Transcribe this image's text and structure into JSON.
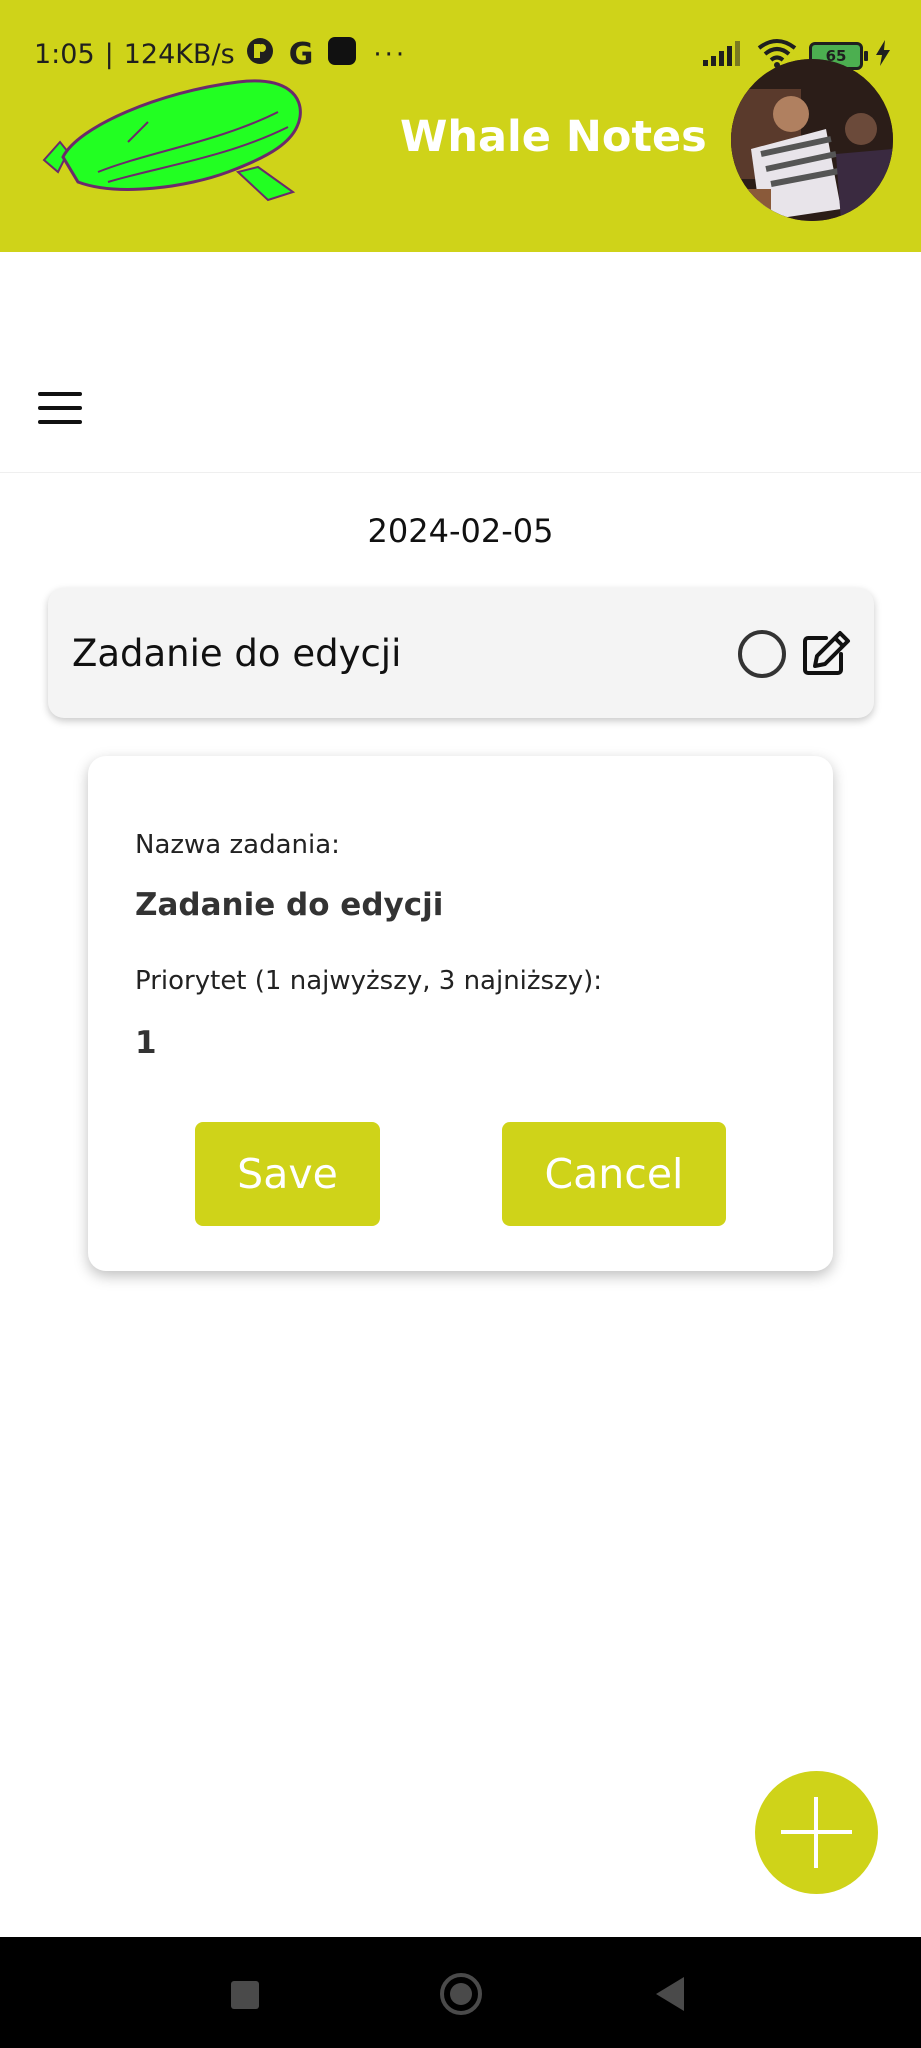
{
  "status_bar": {
    "time": "1:05",
    "separator": "|",
    "network_speed": "124KB/s",
    "icons": [
      "vpn-icon",
      "google-icon",
      "app-icon",
      "more-dots-icon",
      "signal-icon",
      "wifi-icon",
      "battery-icon",
      "charging-icon"
    ],
    "more": "···",
    "battery_level": "65"
  },
  "header": {
    "app_title": "Whale Notes",
    "background_color": "#cfd319",
    "logo": "whale-logo-icon",
    "avatar": "user-avatar"
  },
  "toolbar": {
    "menu_icon": "hamburger-menu-icon"
  },
  "date": "2024-02-05",
  "task": {
    "title": "Zadanie do edycji",
    "completed": false,
    "status_icon": "circle-outline-icon",
    "edit_icon": "edit-icon"
  },
  "edit_dialog": {
    "name_label": "Nazwa zadania:",
    "name_value": "Zadanie do edycji",
    "priority_label": "Priorytet (1 najwyższy, 3 najniższy):",
    "priority_value": "1",
    "save_label": "Save",
    "cancel_label": "Cancel"
  },
  "fab": {
    "icon": "plus-icon",
    "color": "#cfd319"
  },
  "nav_bar": {
    "icons": [
      "recents-icon",
      "home-icon",
      "back-icon"
    ]
  }
}
